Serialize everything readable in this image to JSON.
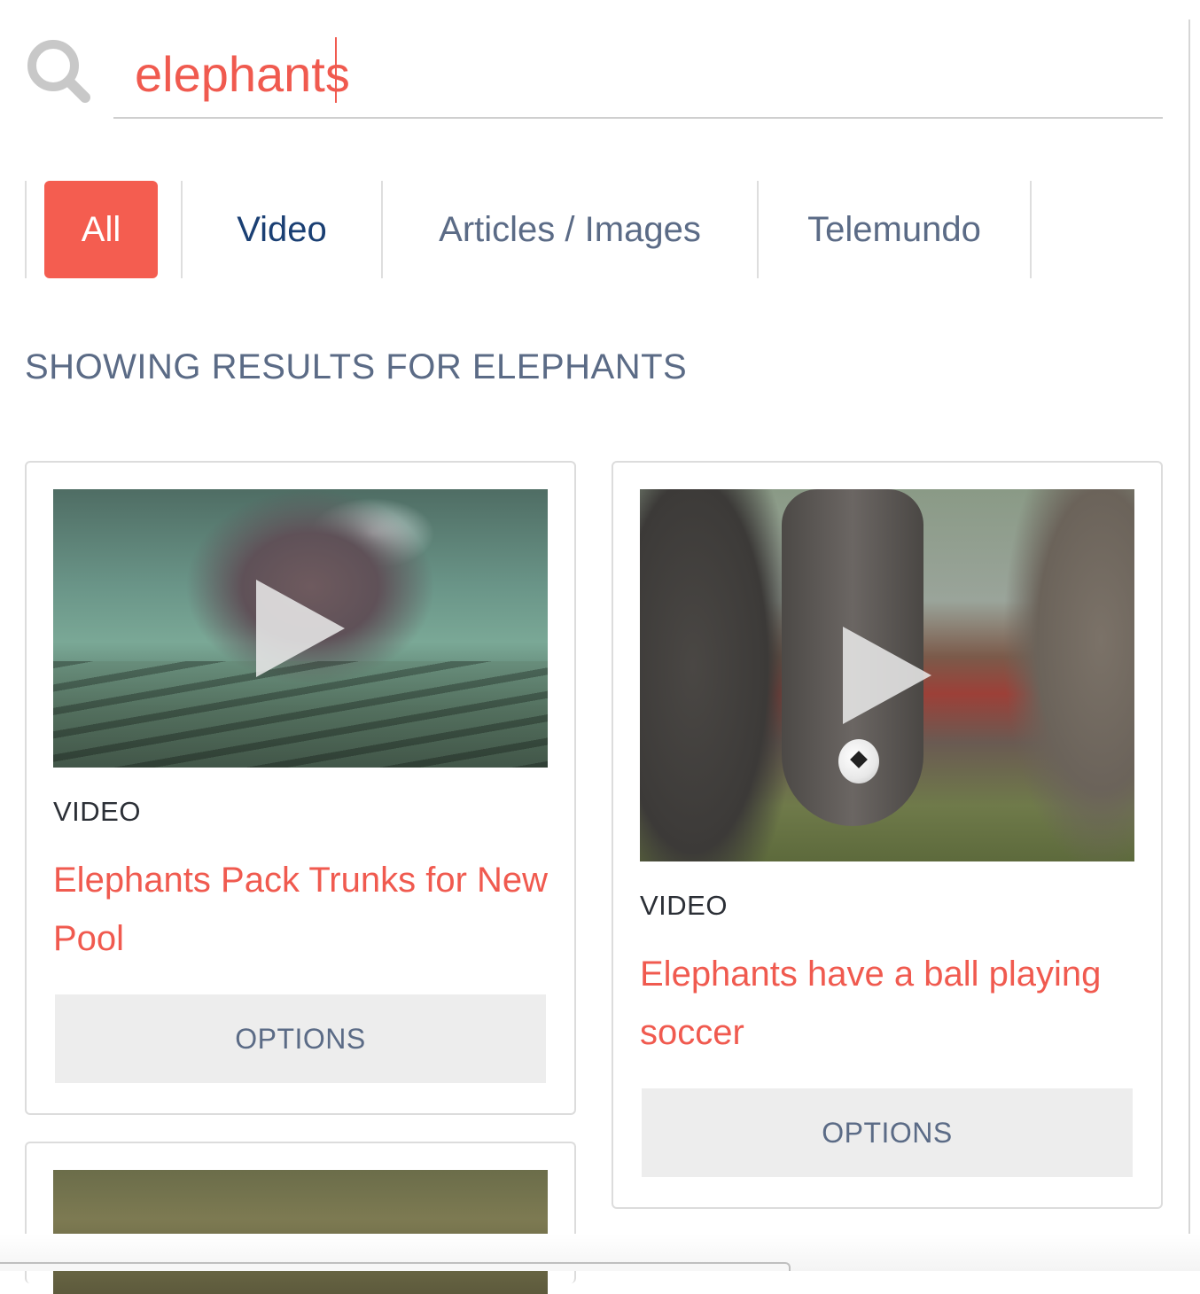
{
  "search": {
    "value": "elephants",
    "icon": "search-icon"
  },
  "tabs": [
    {
      "label": "All",
      "active": true
    },
    {
      "label": "Video",
      "active": false
    },
    {
      "label": "Articles / Images",
      "active": false
    },
    {
      "label": "Telemundo",
      "active": false
    }
  ],
  "results_heading": "SHOWING RESULTS FOR ELEPHANTS",
  "cards": [
    {
      "type_label": "VIDEO",
      "title": "Elephants Pack Trunks for New Pool",
      "options_label": "OPTIONS"
    },
    {
      "type_label": "VIDEO",
      "title": "Elephants have a ball playing soccer",
      "options_label": "OPTIONS"
    }
  ],
  "colors": {
    "accent": "#f45d50",
    "title_red": "#f05a4f",
    "muted_blue": "#5b6b86",
    "dark_blue": "#1a3f73"
  }
}
